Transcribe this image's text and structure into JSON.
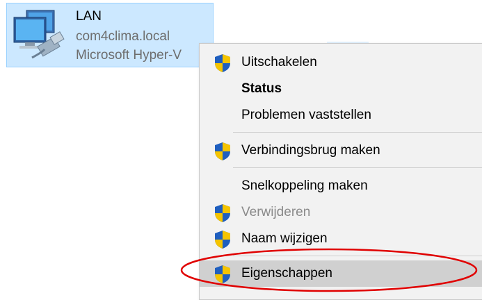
{
  "adapter": {
    "name": "LAN",
    "domain": "com4clima.local",
    "device": "Microsoft Hyper-V",
    "icon": "network-adapter-icon"
  },
  "context_menu": {
    "items": [
      {
        "label": "Uitschakelen",
        "shield": true,
        "bold": false,
        "disabled": false
      },
      {
        "label": "Status",
        "shield": false,
        "bold": true,
        "disabled": false
      },
      {
        "label": "Problemen vaststellen",
        "shield": false,
        "bold": false,
        "disabled": false
      },
      {
        "label": "Verbindingsbrug maken",
        "shield": true,
        "bold": false,
        "disabled": false
      },
      {
        "label": "Snelkoppeling maken",
        "shield": false,
        "bold": false,
        "disabled": false
      },
      {
        "label": "Verwijderen",
        "shield": true,
        "bold": false,
        "disabled": true
      },
      {
        "label": "Naam wijzigen",
        "shield": true,
        "bold": false,
        "disabled": false
      },
      {
        "label": "Eigenschappen",
        "shield": true,
        "bold": false,
        "disabled": false,
        "highlighted": true
      }
    ],
    "shield_icon": "uac-shield-icon"
  },
  "colors": {
    "selection_bg": "#cce8ff",
    "menu_bg": "#f2f2f2",
    "highlight_bg": "#d0d0d0",
    "annotation": "#e00000"
  }
}
